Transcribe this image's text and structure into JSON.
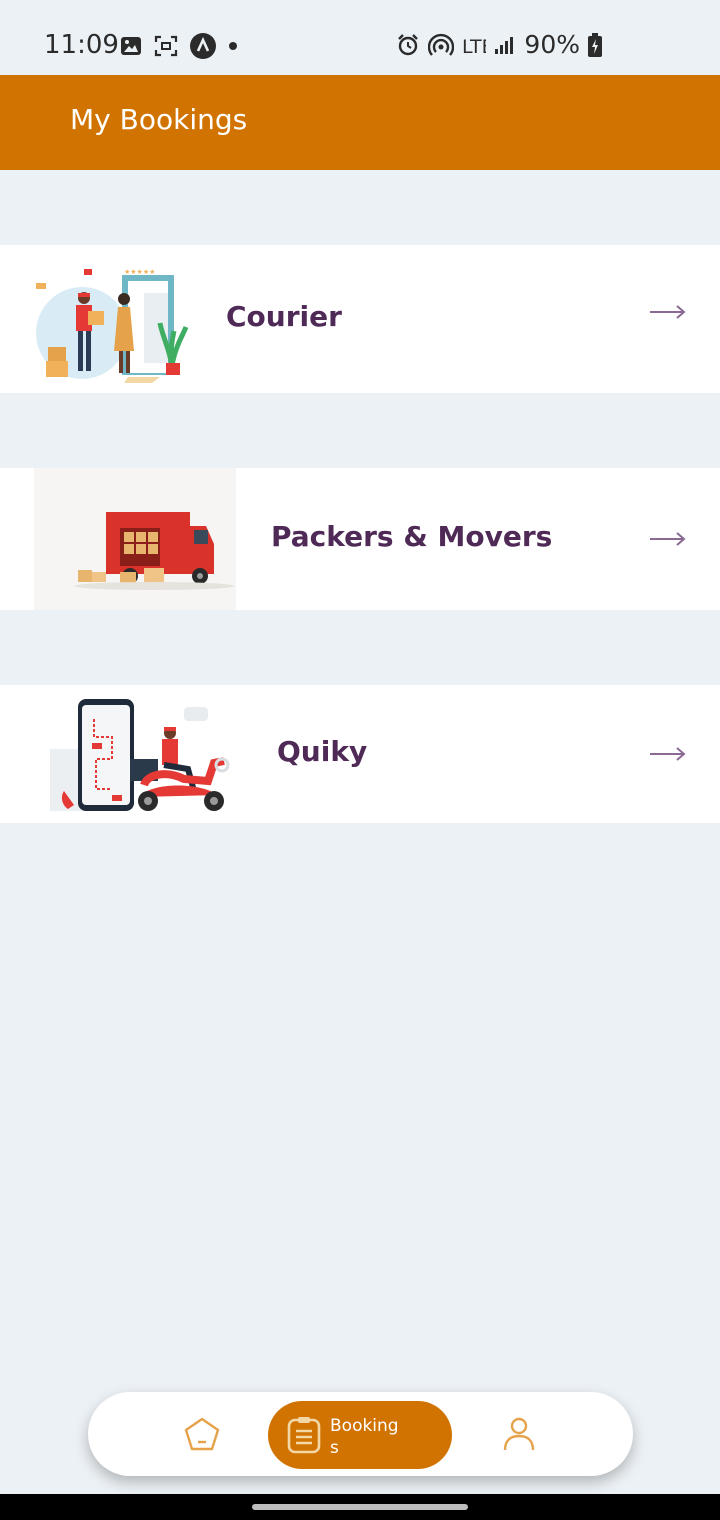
{
  "status_bar": {
    "time": "11:09",
    "battery": "90%",
    "network": "LTE"
  },
  "header": {
    "title": "My Bookings"
  },
  "services": [
    {
      "label": "Courier"
    },
    {
      "label": "Packers & Movers"
    },
    {
      "label": "Quiky"
    }
  ],
  "bottom_nav": {
    "active_label": "Bookings"
  },
  "colors": {
    "brand": "#d17300",
    "label": "#4f2a57",
    "background": "#ecf1f5"
  }
}
